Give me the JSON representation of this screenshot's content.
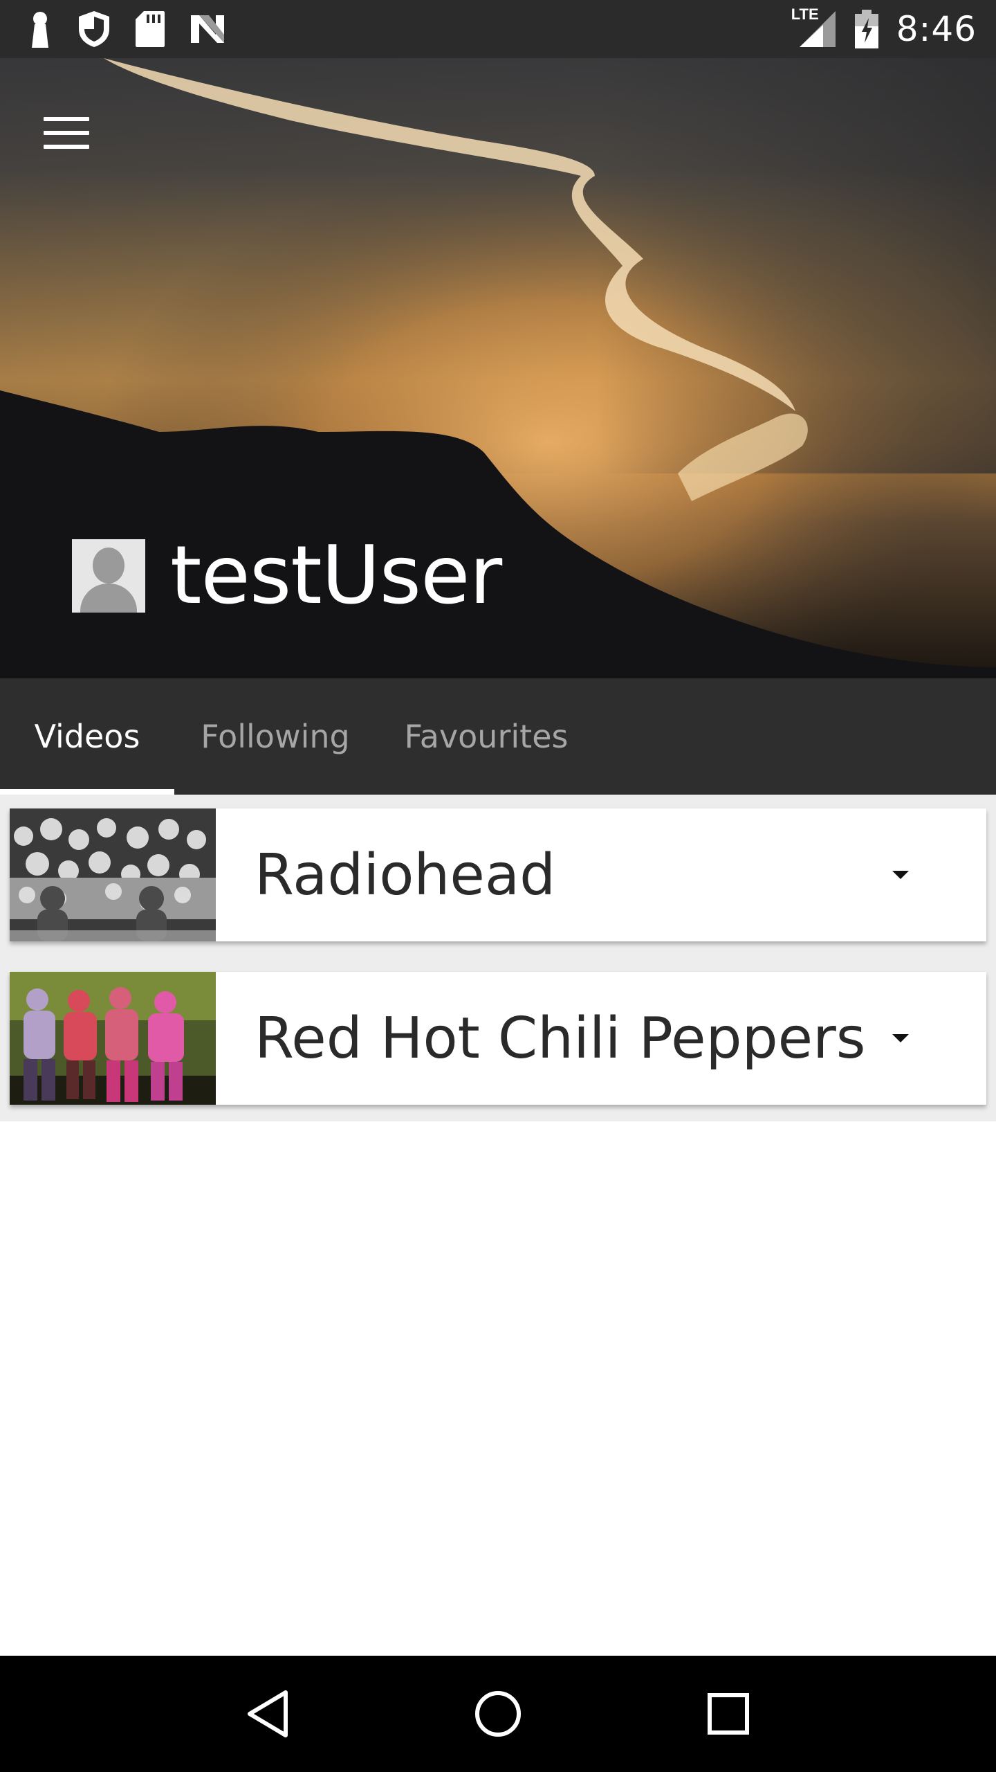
{
  "status_bar": {
    "time": "8:46",
    "network": "LTE",
    "left_icons": [
      "keyhole-icon",
      "shield-icon",
      "sd-card-icon",
      "n-logo-icon"
    ],
    "right_icons": [
      "signal-icon",
      "battery-charging-icon"
    ]
  },
  "header": {
    "menu_icon": "hamburger-menu-icon",
    "username": "testUser",
    "avatar_icon": "default-avatar-icon"
  },
  "tabs": [
    {
      "label": "Videos",
      "active": true
    },
    {
      "label": "Following",
      "active": false
    },
    {
      "label": "Favourites",
      "active": false
    }
  ],
  "videos": [
    {
      "title": "Radiohead",
      "thumbnail": "radiohead-thumbnail",
      "action_icon": "dropdown-arrow-icon"
    },
    {
      "title": "Red Hot Chili Peppers",
      "thumbnail": "rhcp-thumbnail",
      "action_icon": "dropdown-arrow-icon"
    }
  ],
  "nav_bar": {
    "buttons": [
      "back-icon",
      "home-icon",
      "recents-icon"
    ]
  },
  "colors": {
    "status_bar": "#2b2b2b",
    "tab_bar": "#2e2e2e",
    "tab_active": "#ffffff",
    "tab_inactive": "#a6a6a6",
    "list_background": "#ededed",
    "nav_bar": "#000000"
  }
}
